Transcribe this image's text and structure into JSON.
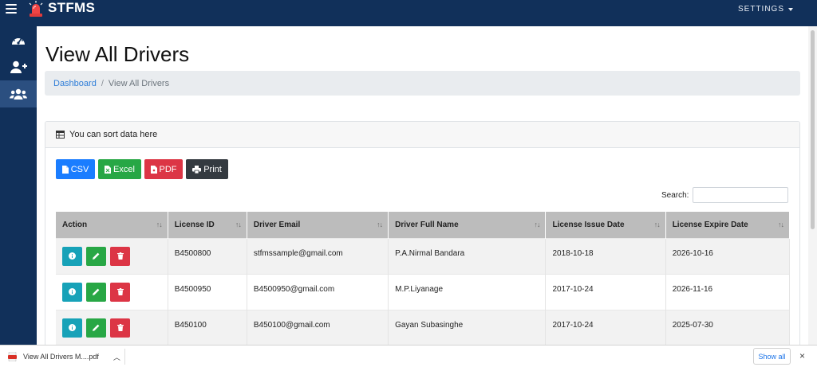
{
  "navbar": {
    "brand": "STFMS",
    "settings_label": "SETTINGS"
  },
  "sidebar": {
    "items": [
      {
        "icon": "dashboard-icon"
      },
      {
        "icon": "add-user-icon"
      },
      {
        "icon": "users-icon",
        "active": true
      }
    ]
  },
  "page": {
    "title": "View All Drivers"
  },
  "breadcrumb": {
    "home": "Dashboard",
    "separator": "/",
    "current": "View All Drivers"
  },
  "card": {
    "header": "You can sort data here"
  },
  "export_buttons": {
    "csv": "CSV",
    "excel": "Excel",
    "pdf": "PDF",
    "print": "Print"
  },
  "search": {
    "label": "Search:",
    "value": ""
  },
  "table": {
    "columns": [
      "Action",
      "License ID",
      "Driver Email",
      "Driver Full Name",
      "License Issue Date",
      "License Expire Date"
    ],
    "sort_glyph": "↑↓",
    "rows": [
      {
        "license_id": "B4500800",
        "email": "stfmssample@gmail.com",
        "name": "P.A.Nirmal Bandara",
        "issue": "2018-10-18",
        "expire": "2026-10-16"
      },
      {
        "license_id": "B4500950",
        "email": "B4500950@gmail.com",
        "name": "M.P.Liyanage",
        "issue": "2017-10-24",
        "expire": "2026-11-16"
      },
      {
        "license_id": "B450100",
        "email": "B450100@gmail.com",
        "name": "Gayan Subasinghe",
        "issue": "2017-10-24",
        "expire": "2025-07-30"
      }
    ]
  },
  "download_bar": {
    "file_name": "View All Drivers M....pdf",
    "show_all": "Show all",
    "close": "×"
  },
  "colors": {
    "navbar": "#11305a",
    "primary": "#1a7dff",
    "success": "#27a745",
    "danger": "#dc3545",
    "dark": "#343a40",
    "info": "#17a2b8"
  }
}
